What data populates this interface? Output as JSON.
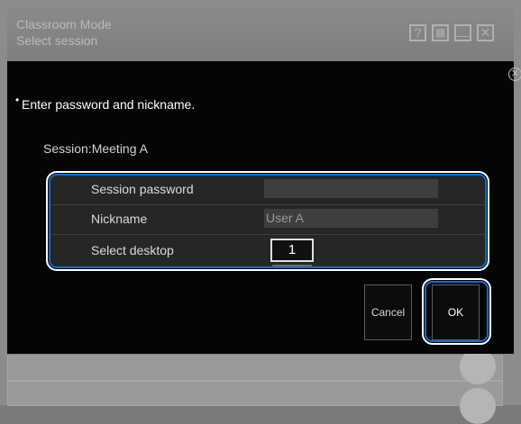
{
  "window": {
    "title": "Classroom Mode",
    "subtitle": "Select session",
    "buttons": [
      {
        "name": "help-icon",
        "glyph": "?"
      },
      {
        "name": "grid-icon",
        "glyph": "▦"
      },
      {
        "name": "minimize-icon",
        "glyph": "—"
      },
      {
        "name": "close-window-icon",
        "glyph": "✕"
      }
    ]
  },
  "dialog": {
    "close_glyph": "✕",
    "instruction": "Enter password and nickname.",
    "bullet": "•",
    "session": "Session:Meeting A",
    "fields": {
      "password_label": "Session password",
      "password_value": "",
      "nickname_label": "Nickname",
      "nickname_value": "User A",
      "desktop_label": "Select desktop",
      "desktop_value": "1"
    },
    "cancel_label": "Cancel",
    "ok_label": "OK"
  }
}
